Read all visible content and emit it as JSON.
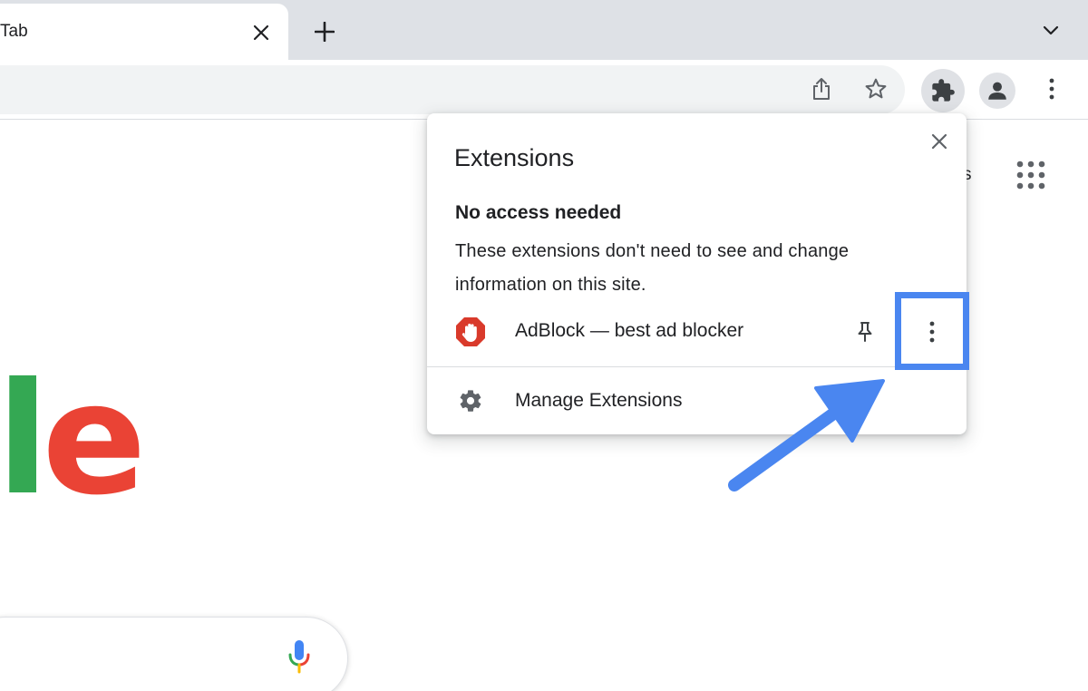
{
  "browser": {
    "tab": {
      "title": "Tab"
    },
    "colors": {
      "tabstrip": "#dee1e6",
      "omnibox": "#f1f3f4",
      "icon": "#5f6368"
    },
    "icons": {
      "tab_close": "close-icon",
      "new_tab": "plus-icon",
      "tab_search": "chevron-down-icon",
      "share": "share-icon",
      "bookmark": "star-icon",
      "extensions": "puzzle-icon",
      "profile": "person-icon",
      "menu": "kebab-icon"
    }
  },
  "page": {
    "peek_text": "s",
    "logo": {
      "letters": [
        "l",
        "e"
      ],
      "colors": [
        "#34a853",
        "#ea4335"
      ]
    },
    "icons": {
      "apps": "grid-icon",
      "voice": "mic-icon"
    }
  },
  "extensions_popup": {
    "title": "Extensions",
    "section_title": "No access needed",
    "section_description": "These extensions don't need to see and change information on this site.",
    "items": [
      {
        "name": "AdBlock — best ad blocker",
        "icon": "adblock-hand-icon",
        "icon_color": "#d93a2b"
      }
    ],
    "manage_label": "Manage Extensions",
    "icons": {
      "close": "close-icon",
      "pin": "pin-icon",
      "more": "kebab-icon",
      "manage": "gear-icon"
    }
  },
  "annotation": {
    "color": "#4a86f0"
  }
}
